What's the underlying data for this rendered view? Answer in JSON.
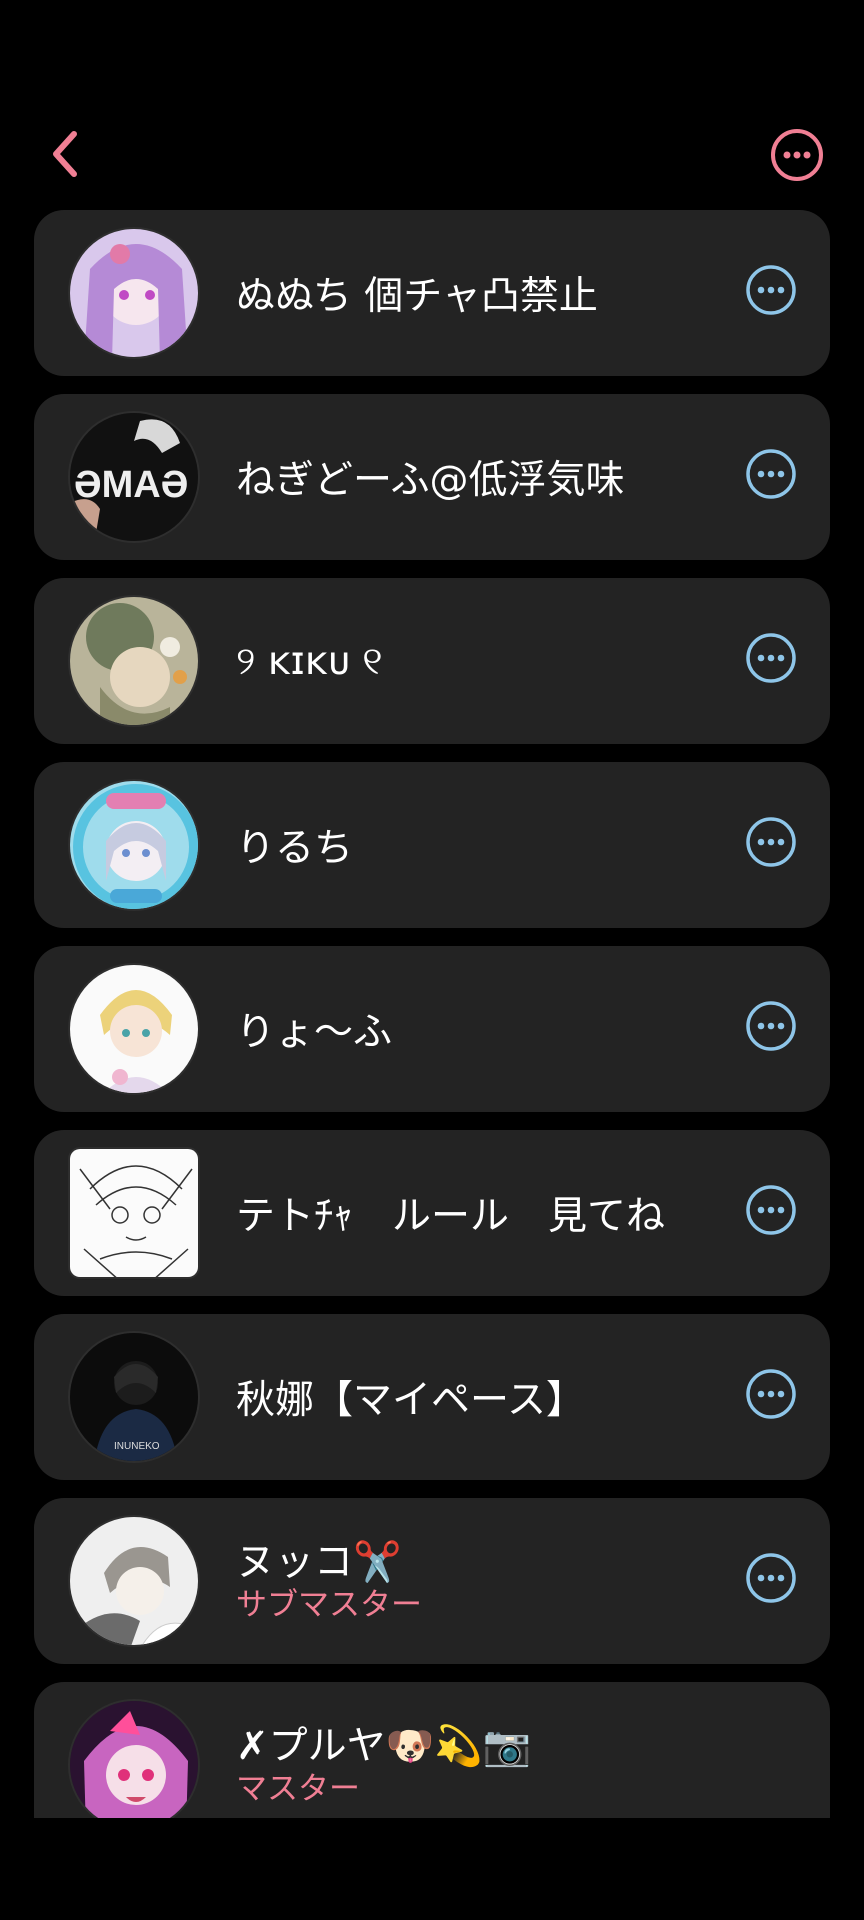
{
  "header": {
    "back_icon": "chevron-left-icon",
    "more_icon": "more-circle-icon",
    "accent_color": "#f07f94"
  },
  "members": [
    {
      "name": "ぬぬち 個チャ凸禁止",
      "role": ""
    },
    {
      "name": "ねぎどーふ@低浮気味",
      "role": ""
    },
    {
      "name": "୨ ᴋɪᴋᴜ ୧",
      "role": ""
    },
    {
      "name": "りるち",
      "role": ""
    },
    {
      "name": "りょ〜ふ",
      "role": ""
    },
    {
      "name": "テトﾁｬ　ルール　見てね",
      "role": ""
    },
    {
      "name": "秋娜【マイペース】",
      "role": ""
    },
    {
      "name": "ヌッコ✂️",
      "role": "サブマスター"
    },
    {
      "name": "✗プルヤ🐶💫📷",
      "role": "マスター"
    }
  ],
  "colors": {
    "card_bg": "#232323",
    "row_more_icon": "#8ec5e8",
    "role_text": "#f07f94"
  }
}
